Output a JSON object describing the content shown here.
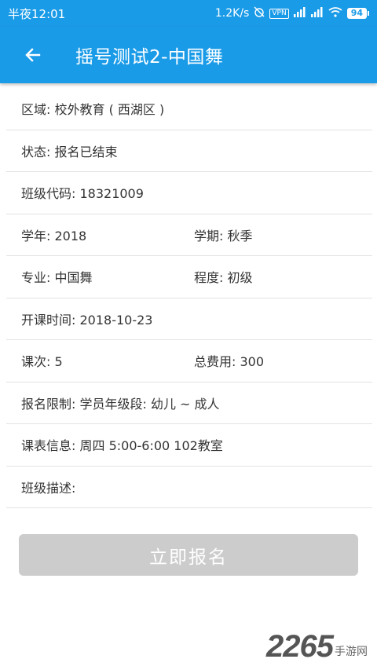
{
  "status_bar": {
    "time": "半夜12:01",
    "network_speed": "1.2K/s",
    "vpn": "VPN",
    "battery": "94"
  },
  "header": {
    "title": "摇号测试2-中国舞"
  },
  "rows": [
    {
      "text": "区域: 校外教育 ( 西湖区 )"
    },
    {
      "text": "状态: 报名已结束"
    },
    {
      "text": "班级代码: 18321009"
    },
    {
      "left": "学年: 2018",
      "right": "学期: 秋季"
    },
    {
      "left": "专业: 中国舞",
      "right": "程度: 初级"
    },
    {
      "text": "开课时间: 2018-10-23"
    },
    {
      "left": "课次: 5",
      "right": "总费用: 300"
    },
    {
      "text": "报名限制: 学员年级段: 幼儿 ~ 成人"
    },
    {
      "text": "课表信息: 周四 5:00-6:00 102教室"
    },
    {
      "text": "班级描述:"
    }
  ],
  "signup_button": {
    "label": "立即报名"
  },
  "watermark": {
    "digits": "2265",
    "text": "手游网"
  },
  "colors": {
    "primary": "#1a9be8",
    "button_disabled": "#cccccc",
    "text": "#333333",
    "divider": "#e3e3e3"
  }
}
